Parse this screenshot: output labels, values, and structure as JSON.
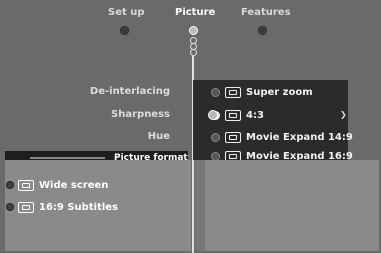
{
  "tabs": [
    {
      "label": "Set up"
    },
    {
      "label": "Picture"
    },
    {
      "label": "Features"
    }
  ],
  "settings": [
    {
      "label": "De-interlacing"
    },
    {
      "label": "Sharpness"
    },
    {
      "label": "Hue"
    }
  ],
  "picture_format": {
    "label": "Picture format",
    "overlay_text": "Picture format"
  },
  "options": [
    {
      "label": "Super zoom"
    },
    {
      "label": "4:3"
    },
    {
      "label": "Movie Expand 14:9"
    },
    {
      "label": "Movie Expand 16:9"
    },
    {
      "label": "Wide screen"
    },
    {
      "label": "16:9 Subtitles"
    }
  ],
  "colors": {
    "panel": "#2b2b2b",
    "background": "#6a6a6a",
    "lower": "#8a8a8a"
  }
}
